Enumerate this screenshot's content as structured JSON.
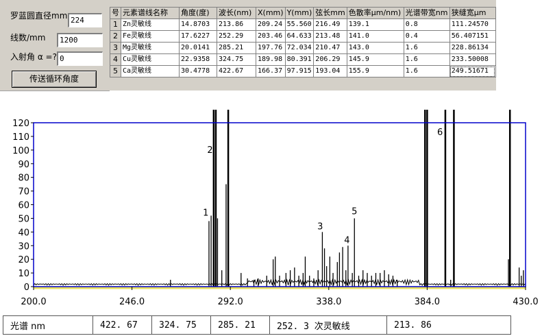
{
  "controls": {
    "diameter_label": "罗蓝圆直径mm",
    "diameter_value": "224",
    "lines_label": "线数/mm",
    "lines_value": "1200",
    "angle_label": "入射角 α =?",
    "angle_value": "0",
    "send_button": "传送循环角度"
  },
  "grid": {
    "headers": [
      "号",
      "元素谱线名称",
      "角度(度)",
      "波长(nm)",
      "X(mm)",
      "Y(mm)",
      "弦长mm",
      "色散率μm/nm)",
      "光谱带宽nm",
      "狭缝宽μm"
    ],
    "rows": [
      [
        "1",
        "Zn灵敏线",
        "14.8703",
        "213.86",
        "209.24",
        "55.560",
        "216.49",
        "139.1",
        "0.8",
        "111.24570"
      ],
      [
        "2",
        "Fe灵敏线",
        "17.6227",
        "252.29",
        "203.46",
        "64.633",
        "213.48",
        "141.0",
        "0.4",
        "56.407151"
      ],
      [
        "3",
        "Mg灵敏线",
        "20.0141",
        "285.21",
        "197.76",
        "72.034",
        "210.47",
        "143.0",
        "1.6",
        "228.86134"
      ],
      [
        "4",
        "Cu灵敏线",
        "22.9358",
        "324.75",
        "189.98",
        "80.391",
        "206.29",
        "145.9",
        "1.6",
        "233.50008"
      ],
      [
        "5",
        "Ca灵敏线",
        "30.4778",
        "422.67",
        "166.37",
        "97.915",
        "193.04",
        "155.9",
        "1.6",
        "249.51671"
      ]
    ]
  },
  "chart_data": {
    "type": "line",
    "xlim": [
      200,
      430
    ],
    "ylim": [
      0,
      120
    ],
    "xticks": [
      "200.0",
      "246.0",
      "292.0",
      "338.0",
      "384.0",
      "430.0"
    ],
    "yticks": [
      "0",
      "10",
      "20",
      "30",
      "40",
      "50",
      "60",
      "70",
      "80",
      "90",
      "100",
      "110",
      "120"
    ],
    "frame_color": "#0000cc",
    "baseline_color": "#e8e060",
    "peaks": [
      {
        "x": 264.0,
        "y": 5
      },
      {
        "x": 282.0,
        "y": 48
      },
      {
        "x": 283.0,
        "y": 52
      },
      {
        "x": 284.2,
        "y": 130
      },
      {
        "x": 285.2,
        "y": 130
      },
      {
        "x": 286.0,
        "y": 50
      },
      {
        "x": 288.0,
        "y": 12
      },
      {
        "x": 290.0,
        "y": 75
      },
      {
        "x": 291.0,
        "y": 130
      },
      {
        "x": 297.0,
        "y": 10
      },
      {
        "x": 300.0,
        "y": 6
      },
      {
        "x": 303.0,
        "y": 5
      },
      {
        "x": 305.0,
        "y": 6
      },
      {
        "x": 309.0,
        "y": 8
      },
      {
        "x": 312.0,
        "y": 20
      },
      {
        "x": 313.0,
        "y": 22
      },
      {
        "x": 315.0,
        "y": 8
      },
      {
        "x": 318.0,
        "y": 10
      },
      {
        "x": 320.0,
        "y": 12
      },
      {
        "x": 322.0,
        "y": 14
      },
      {
        "x": 324.0,
        "y": 8
      },
      {
        "x": 326.0,
        "y": 10
      },
      {
        "x": 327.0,
        "y": 22
      },
      {
        "x": 329.0,
        "y": 8
      },
      {
        "x": 331.0,
        "y": 6
      },
      {
        "x": 333.0,
        "y": 12
      },
      {
        "x": 335.0,
        "y": 40
      },
      {
        "x": 336.0,
        "y": 28
      },
      {
        "x": 337.0,
        "y": 15
      },
      {
        "x": 338.5,
        "y": 22
      },
      {
        "x": 340.0,
        "y": 10
      },
      {
        "x": 342.0,
        "y": 18
      },
      {
        "x": 343.0,
        "y": 25
      },
      {
        "x": 344.5,
        "y": 29
      },
      {
        "x": 346.0,
        "y": 12
      },
      {
        "x": 347.0,
        "y": 30
      },
      {
        "x": 349.0,
        "y": 10
      },
      {
        "x": 350.0,
        "y": 50
      },
      {
        "x": 352.0,
        "y": 8
      },
      {
        "x": 354.0,
        "y": 12
      },
      {
        "x": 356.0,
        "y": 10
      },
      {
        "x": 358.0,
        "y": 8
      },
      {
        "x": 360.0,
        "y": 10
      },
      {
        "x": 362.0,
        "y": 10
      },
      {
        "x": 364.0,
        "y": 12
      },
      {
        "x": 366.0,
        "y": 9
      },
      {
        "x": 368.0,
        "y": 8
      },
      {
        "x": 370.0,
        "y": 5
      },
      {
        "x": 383.0,
        "y": 130
      },
      {
        "x": 384.0,
        "y": 130
      },
      {
        "x": 392.5,
        "y": 130
      },
      {
        "x": 395.0,
        "y": 5
      },
      {
        "x": 396.5,
        "y": 130
      },
      {
        "x": 422.0,
        "y": 20
      },
      {
        "x": 422.7,
        "y": 130
      },
      {
        "x": 427.0,
        "y": 14
      },
      {
        "x": 428.0,
        "y": 8
      },
      {
        "x": 429.0,
        "y": 12
      }
    ],
    "labels": [
      {
        "text": "1",
        "x": 280.5,
        "y": 52
      },
      {
        "text": "2",
        "x": 282.5,
        "y": 98
      },
      {
        "text": "3",
        "x": 334.0,
        "y": 42
      },
      {
        "text": "4",
        "x": 346.5,
        "y": 32
      },
      {
        "text": "5",
        "x": 350.0,
        "y": 53
      },
      {
        "text": "6",
        "x": 390.0,
        "y": 111
      }
    ]
  },
  "strip": {
    "cells": [
      "光谱 nm",
      "422. 67",
      "324. 75",
      "285. 21",
      "252. 3 次灵敏线",
      "213. 86"
    ]
  }
}
